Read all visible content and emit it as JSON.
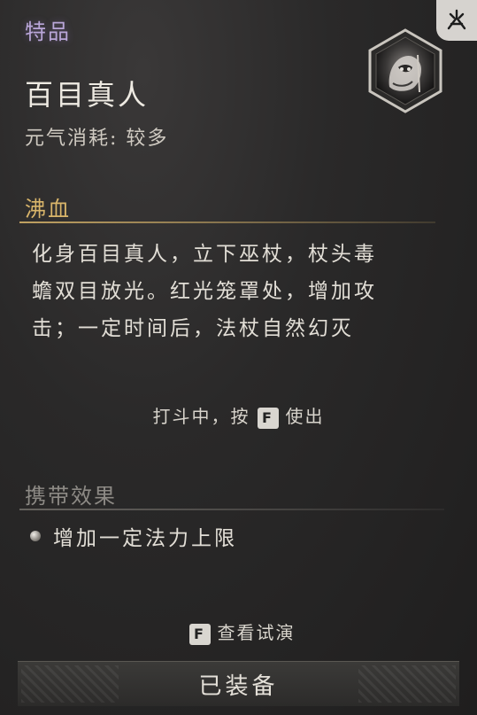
{
  "item": {
    "rarity": "特品",
    "name": "百目真人",
    "cost_label": "元气消耗:",
    "cost_value": "较多",
    "icon": "hundred-eyed-taoist-portrait-icon",
    "corner_icon": "transformation-emblem-icon"
  },
  "ability": {
    "title": "沸血",
    "description_lines": [
      "化身百目真人，立下巫杖，杖头毒",
      "蟾双目放光。红光笼罩处，增加攻",
      "击；一定时间后，法杖自然幻灭"
    ],
    "hint_prefix": "打斗中，按",
    "hint_key": "F",
    "hint_suffix": "使出"
  },
  "carry": {
    "title": "携带效果",
    "effect": "增加一定法力上限"
  },
  "preview": {
    "key": "F",
    "label": "查看试演"
  },
  "equip_button": "已装备",
  "colors": {
    "rarity": "#b9a6d8",
    "ability_title": "#d9b56a",
    "carry_title": "#8d8a85",
    "background": "#2a2929"
  }
}
